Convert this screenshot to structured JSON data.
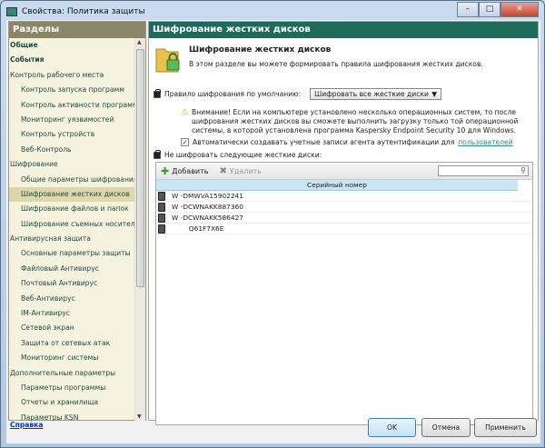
{
  "window": {
    "title": "Свойства: Политика защиты",
    "minimize": "–",
    "maximize": "□",
    "close": "✕"
  },
  "sidebar": {
    "header": "Разделы",
    "items": [
      {
        "label": "Общие",
        "level": 0,
        "bold": true
      },
      {
        "label": "События",
        "level": 0,
        "bold": true
      },
      {
        "label": "Контроль рабочего места",
        "level": 0
      },
      {
        "label": "Контроль запуска программ",
        "level": 1
      },
      {
        "label": "Контроль активности программ",
        "level": 1
      },
      {
        "label": "Мониторинг уязвимостей",
        "level": 1
      },
      {
        "label": "Контроль устройств",
        "level": 1
      },
      {
        "label": "Веб-Контроль",
        "level": 1
      },
      {
        "label": "Шифрование",
        "level": 0
      },
      {
        "label": "Общие параметры шифрования",
        "level": 1
      },
      {
        "label": "Шифрование жестких дисков",
        "level": 1,
        "selected": true
      },
      {
        "label": "Шифрование файлов и папок",
        "level": 1
      },
      {
        "label": "Шифрование съемных носителей",
        "level": 1
      },
      {
        "label": "Антивирусная защита",
        "level": 0
      },
      {
        "label": "Основные параметры защиты",
        "level": 1
      },
      {
        "label": "Файловый Антивирус",
        "level": 1
      },
      {
        "label": "Почтовый Антивирус",
        "level": 1
      },
      {
        "label": "Веб-Антивирус",
        "level": 1
      },
      {
        "label": "IM-Антивирус",
        "level": 1
      },
      {
        "label": "Сетевой экран",
        "level": 1
      },
      {
        "label": "Защита от сетевых атак",
        "level": 1
      },
      {
        "label": "Мониторинг системы",
        "level": 1
      },
      {
        "label": "Дополнительные параметры",
        "level": 0
      },
      {
        "label": "Параметры программы",
        "level": 1
      },
      {
        "label": "Отчеты и хранилища",
        "level": 1
      },
      {
        "label": "Параметры KSN",
        "level": 1
      }
    ]
  },
  "main": {
    "header": "Шифрование жестких дисков",
    "title": "Шифрование жестких дисков",
    "description": "В этом разделе вы можете формировать правила шифрования жестких дисков.",
    "rule_label": "Правило шифрования по умолчанию:",
    "rule_value": "Шифровать все жесткие диски",
    "warning": "Внимание! Если на компьютере установлено несколько операционных систем, то после шифрования жестких дисков вы сможете выполнить загрузку только той операционной системы, в которой установлена программа Kaspersky Endpoint Security 10 для Windows.",
    "auto_create_label": "Автоматически создавать учетные записи агента аутентификации для",
    "auto_create_link": "пользователей",
    "auto_create_checked": true,
    "exclude_label": "Не шифровать следующие жесткие диски:",
    "toolbar": {
      "add": "Добавить",
      "delete": "Удалить",
      "search_value": ""
    },
    "column": "Серийный номер",
    "disks": [
      "W -DMWVA15902241",
      "W -DCWNAKK887360",
      "W -DCWNAKK586427",
      "        Q61F7X6E"
    ]
  },
  "footer": {
    "help": "Справка",
    "ok": "OK",
    "cancel": "Отмена",
    "apply": "Применить"
  }
}
